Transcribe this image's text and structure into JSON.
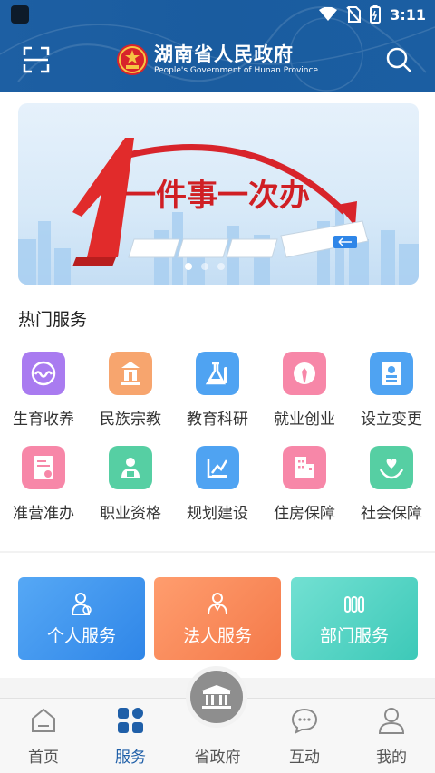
{
  "status_bar": {
    "time": "3:11"
  },
  "header": {
    "title_cn": "湖南省人民政府",
    "title_en": "People's Government of Hunan Province"
  },
  "banner": {
    "slogan": "一件事一次办",
    "slide_count": 3,
    "active_slide": 1
  },
  "hot_services": {
    "title": "热门服务",
    "items": [
      {
        "label": "生育收养",
        "icon": "baby-wave-icon",
        "color": "#a97bf0"
      },
      {
        "label": "民族宗教",
        "icon": "temple-icon",
        "color": "#f7a56e"
      },
      {
        "label": "教育科研",
        "icon": "flask-icon",
        "color": "#4fa3f2"
      },
      {
        "label": "就业创业",
        "icon": "suit-tie-icon",
        "color": "#f787a8"
      },
      {
        "label": "设立变更",
        "icon": "id-card-icon",
        "color": "#4fa3f2"
      },
      {
        "label": "准营准办",
        "icon": "license-icon",
        "color": "#f787a8"
      },
      {
        "label": "职业资格",
        "icon": "people-cert-icon",
        "color": "#56cfa3"
      },
      {
        "label": "规划建设",
        "icon": "blueprint-icon",
        "color": "#4fa3f2"
      },
      {
        "label": "住房保障",
        "icon": "building-icon",
        "color": "#f787a8"
      },
      {
        "label": "社会保障",
        "icon": "heart-hands-icon",
        "color": "#56cfa3"
      }
    ]
  },
  "categories": [
    {
      "label": "个人服务",
      "icon": "person-service-icon"
    },
    {
      "label": "法人服务",
      "icon": "legal-person-icon"
    },
    {
      "label": "部门服务",
      "icon": "department-icon"
    }
  ],
  "tabbar": {
    "active": "服务",
    "items": [
      {
        "label": "首页",
        "icon": "home-icon"
      },
      {
        "label": "服务",
        "icon": "grid-icon"
      },
      {
        "label": "省政府",
        "icon": "government-building-icon"
      },
      {
        "label": "互动",
        "icon": "chat-bubble-icon"
      },
      {
        "label": "我的",
        "icon": "user-icon"
      }
    ]
  },
  "colors": {
    "header_blue": "#1b5ea2",
    "tab_active": "#1f5fa8"
  }
}
